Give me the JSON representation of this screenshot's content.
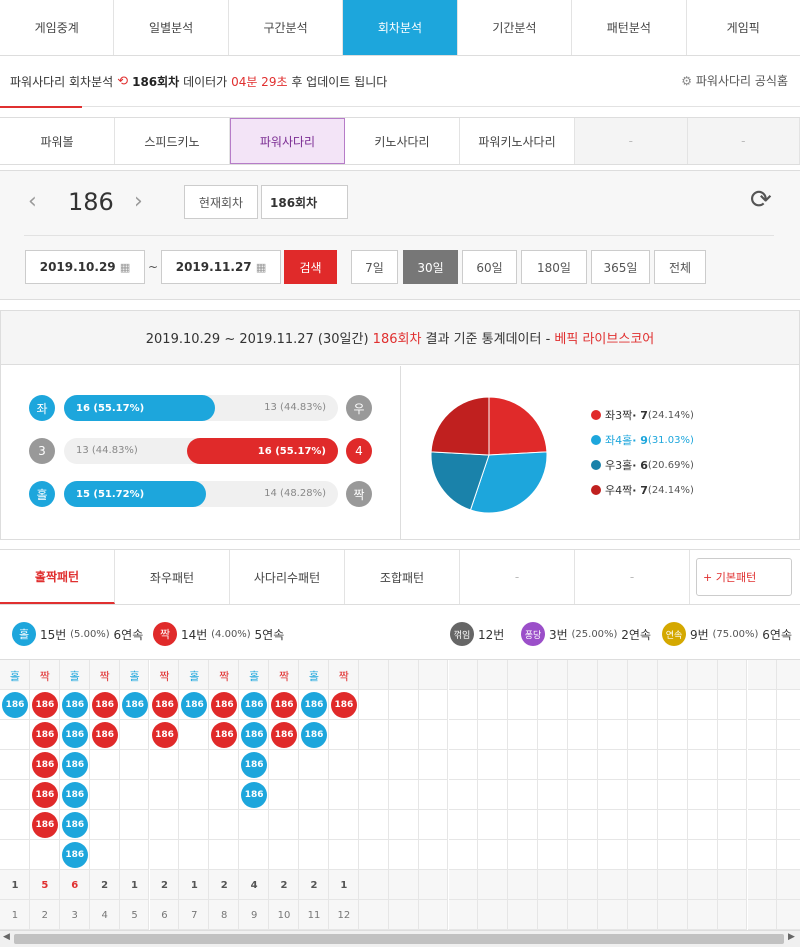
{
  "top_tabs": [
    "게임중계",
    "일별분석",
    "구간분석",
    "회차분석",
    "기간분석",
    "패턴분석",
    "게임픽"
  ],
  "top_active": 3,
  "info": {
    "prefix": "파워사다리 회차분석",
    "round": "186회차",
    "mid": "데이터가",
    "time": "04분 29초",
    "suffix": "후 업데이트 됩니다",
    "link": "파워사다리 공식홈"
  },
  "sub_tabs": [
    "파워볼",
    "스피드키노",
    "파워사다리",
    "키노사다리",
    "파워키노사다리",
    "-",
    "-"
  ],
  "sub_active": 2,
  "control": {
    "round": "186",
    "current_btn": "현재회차",
    "round_input": "186회차",
    "date_from": "2019.10.29",
    "tilde": "~",
    "date_to": "2019.11.27",
    "search": "검색",
    "periods": [
      "7일",
      "30일",
      "60일",
      "180일",
      "365일",
      "전체"
    ],
    "period_active": 1
  },
  "stats": {
    "head_prefix": "2019.10.29 ~ 2019.11.27 (30일간)",
    "head_round": "186회차",
    "head_mid": "결과 기준 통계데이터 -",
    "head_brand": "베픽 라이브스코어",
    "rows": [
      {
        "left": "좌",
        "right": "우",
        "lval": "16 (55.17%)",
        "rval": "13 (44.83%)",
        "lpct": 55.17,
        "side": "left",
        "color": "#1da6dc"
      },
      {
        "left": "3",
        "right": "4",
        "lval": "13 (44.83%)",
        "rval": "16 (55.17%)",
        "lpct": 44.83,
        "side": "right",
        "color": "#e02a2a"
      },
      {
        "left": "홀",
        "right": "짝",
        "lval": "15 (51.72%)",
        "rval": "14 (48.28%)",
        "lpct": 51.72,
        "side": "left",
        "color": "#1da6dc"
      }
    ],
    "legend": [
      {
        "label": "좌3짝",
        "val": "7",
        "pct": "(24.14%)",
        "color": "#e02a2a"
      },
      {
        "label": "좌4홀",
        "val": "9",
        "pct": "(31.03%)",
        "color": "#1da6dc"
      },
      {
        "label": "우3홀",
        "val": "6",
        "pct": "(20.69%)",
        "color": "#1a82aa"
      },
      {
        "label": "우4짝",
        "val": "7",
        "pct": "(24.14%)",
        "color": "#c0201f"
      }
    ]
  },
  "chart_data": {
    "type": "pie",
    "values": [
      24.14,
      31.03,
      20.69,
      24.14
    ],
    "labels": [
      "좌3짝",
      "좌4홀",
      "우3홀",
      "우4짝"
    ],
    "colors": [
      "#e02a2a",
      "#1da6dc",
      "#1a82aa",
      "#c0201f"
    ]
  },
  "pattern_tabs": [
    "홀짝패턴",
    "좌우패턴",
    "사다리수패턴",
    "조합패턴",
    "-",
    "-"
  ],
  "pattern_btn": "+ 기본패턴",
  "summary": {
    "odd": {
      "label": "홀",
      "count": "15번",
      "pct": "(5.00%)",
      "streak": "6연속"
    },
    "even": {
      "label": "짝",
      "count": "14번",
      "pct": "(4.00%)",
      "streak": "5연속"
    },
    "break": {
      "label": "꺾임",
      "count": "12번"
    },
    "pongdang": {
      "label": "퐁당",
      "count": "3번",
      "pct": "(25.00%)",
      "streak": "2연속"
    },
    "cont": {
      "label": "연속",
      "count": "9번",
      "pct": "(75.00%)",
      "streak": "6연속"
    }
  },
  "columns": [
    {
      "h": "홀",
      "n": 1,
      "c": "1"
    },
    {
      "h": "짝",
      "n": 5,
      "c": "5"
    },
    {
      "h": "홀",
      "n": 6,
      "c": "6"
    },
    {
      "h": "짝",
      "n": 2,
      "c": "2"
    },
    {
      "h": "홀",
      "n": 1,
      "c": "1"
    },
    {
      "h": "짝",
      "n": 2,
      "c": "2"
    },
    {
      "h": "홀",
      "n": 1,
      "c": "1"
    },
    {
      "h": "짝",
      "n": 2,
      "c": "2"
    },
    {
      "h": "홀",
      "n": 4,
      "c": "4"
    },
    {
      "h": "짝",
      "n": 2,
      "c": "2"
    },
    {
      "h": "홀",
      "n": 2,
      "c": "2"
    },
    {
      "h": "짝",
      "n": 1,
      "c": "1"
    }
  ],
  "ball_label": "186",
  "idx": [
    "1",
    "2",
    "3",
    "4",
    "5",
    "6",
    "7",
    "8",
    "9",
    "10",
    "11",
    "12"
  ]
}
